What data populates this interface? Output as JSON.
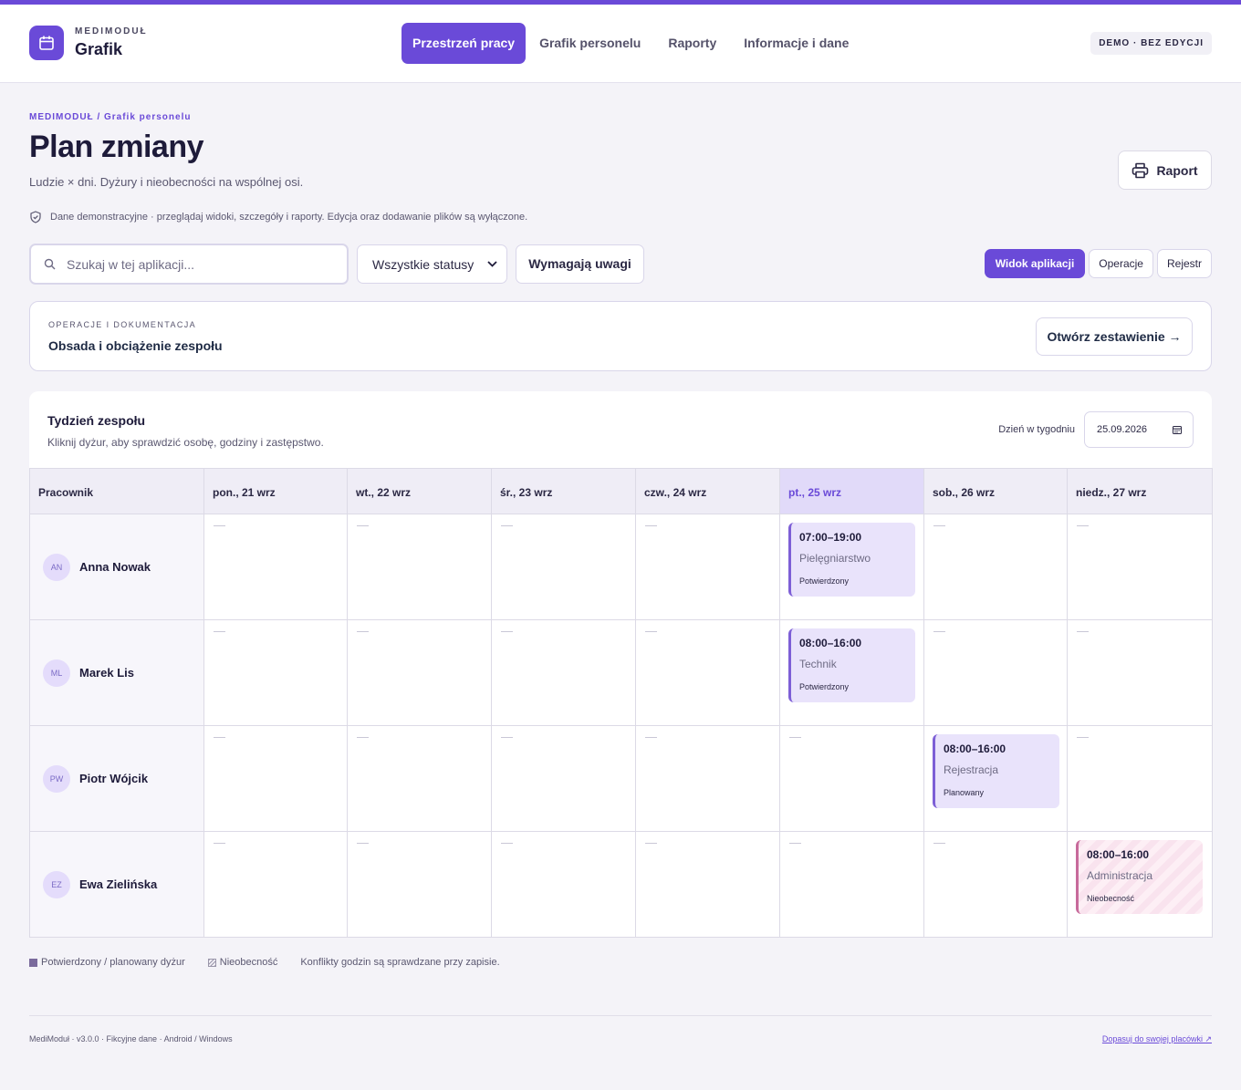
{
  "app": {
    "kicker": "MEDIMODUŁ",
    "title": "Grafik",
    "accent_color": "#6a4ad8",
    "logo_icon": "calendar-icon"
  },
  "nav": {
    "items": [
      {
        "label": "Przestrzeń pracy",
        "active": true
      },
      {
        "label": "Grafik personelu",
        "active": false
      },
      {
        "label": "Raporty",
        "active": false
      },
      {
        "label": "Informacje i dane",
        "active": false
      }
    ]
  },
  "demo_badge": "DEMO · BEZ EDYCJI",
  "page": {
    "breadcrumb": "MEDIMODUŁ / Grafik personelu",
    "title": "Plan zmiany",
    "subtitle": "Ludzie × dni. Dyżury i nieobecności na wspólnej osi.",
    "report_button": "Raport",
    "notice": "Dane demonstracyjne · przeglądaj widoki, szczegóły i raporty. Edycja oraz dodawanie plików są wyłączone."
  },
  "filters": {
    "search_placeholder": "Szukaj w tej aplikacji...",
    "status_selected": "Wszystkie statusy",
    "attention_button": "Wymagają uwagi"
  },
  "view_tabs": [
    {
      "label": "Widok aplikacji",
      "active": true
    },
    {
      "label": "Operacje",
      "active": false
    },
    {
      "label": "Rejestr",
      "active": false
    }
  ],
  "ops_card": {
    "kicker": "OPERACJE I DOKUMENTACJA",
    "title": "Obsada i obciążenie zespołu",
    "button": "Otwórz zestawienie →"
  },
  "week": {
    "title": "Tydzień zespołu",
    "subtitle": "Kliknij dyżur, aby sprawdzić osobę, godziny i zastępstwo.",
    "day_label": "Dzień w tygodniu",
    "date_value": "25.09.2026",
    "employee_header": "Pracownik",
    "days": [
      "pon., 21 wrz",
      "wt., 22 wrz",
      "śr., 23 wrz",
      "czw., 24 wrz",
      "pt., 25 wrz",
      "sob., 26 wrz",
      "niedz., 27 wrz"
    ],
    "today_index": 4,
    "rows": [
      {
        "initials": "AN",
        "name": "Anna Nowak",
        "shifts": [
          null,
          null,
          null,
          null,
          {
            "time": "07:00–19:00",
            "role": "Pielęgniarstwo",
            "status": "Potwierdzony",
            "absence": false
          },
          null,
          null
        ]
      },
      {
        "initials": "ML",
        "name": "Marek Lis",
        "shifts": [
          null,
          null,
          null,
          null,
          {
            "time": "08:00–16:00",
            "role": "Technik",
            "status": "Potwierdzony",
            "absence": false
          },
          null,
          null
        ]
      },
      {
        "initials": "PW",
        "name": "Piotr Wójcik",
        "shifts": [
          null,
          null,
          null,
          null,
          null,
          {
            "time": "08:00–16:00",
            "role": "Rejestracja",
            "status": "Planowany",
            "absence": false
          },
          null
        ]
      },
      {
        "initials": "EZ",
        "name": "Ewa Zielińska",
        "shifts": [
          null,
          null,
          null,
          null,
          null,
          null,
          {
            "time": "08:00–16:00",
            "role": "Administracja",
            "status": "Nieobecność",
            "absence": true
          }
        ]
      }
    ]
  },
  "legend": {
    "shift": "Potwierdzony / planowany dyżur",
    "absence": "Nieobecność",
    "note": "Konflikty godzin są sprawdzane przy zapisie."
  },
  "footer": {
    "left": "MediModuł · v3.0.0 · Fikcyjne dane · Android / Windows",
    "link": "Dopasuj do swojej placówki ↗"
  }
}
